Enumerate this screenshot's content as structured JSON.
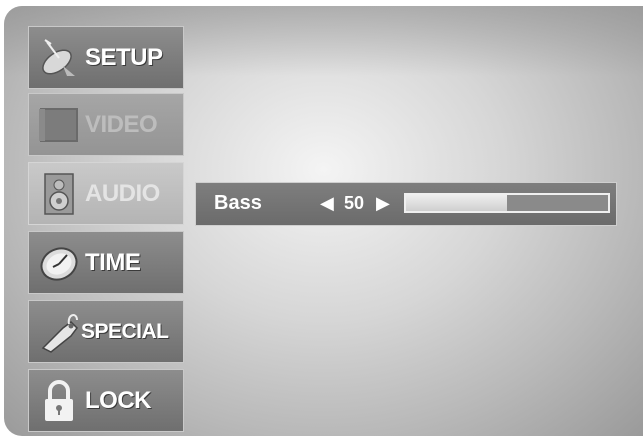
{
  "menu": {
    "items": [
      {
        "label": "SETUP",
        "icon": "satellite-dish-icon",
        "state": "normal"
      },
      {
        "label": "VIDEO",
        "icon": "monitor-icon",
        "state": "dim"
      },
      {
        "label": "AUDIO",
        "icon": "speaker-icon",
        "state": "active"
      },
      {
        "label": "TIME",
        "icon": "clock-icon",
        "state": "normal"
      },
      {
        "label": "SPECIAL",
        "icon": "tag-icon",
        "state": "normal"
      },
      {
        "label": "LOCK",
        "icon": "padlock-icon",
        "state": "normal"
      }
    ]
  },
  "audio": {
    "bass_label": "Bass",
    "bass_value": "50",
    "bass_level_fraction": 0.5,
    "left_arrow": "◀",
    "right_arrow": "▶"
  }
}
